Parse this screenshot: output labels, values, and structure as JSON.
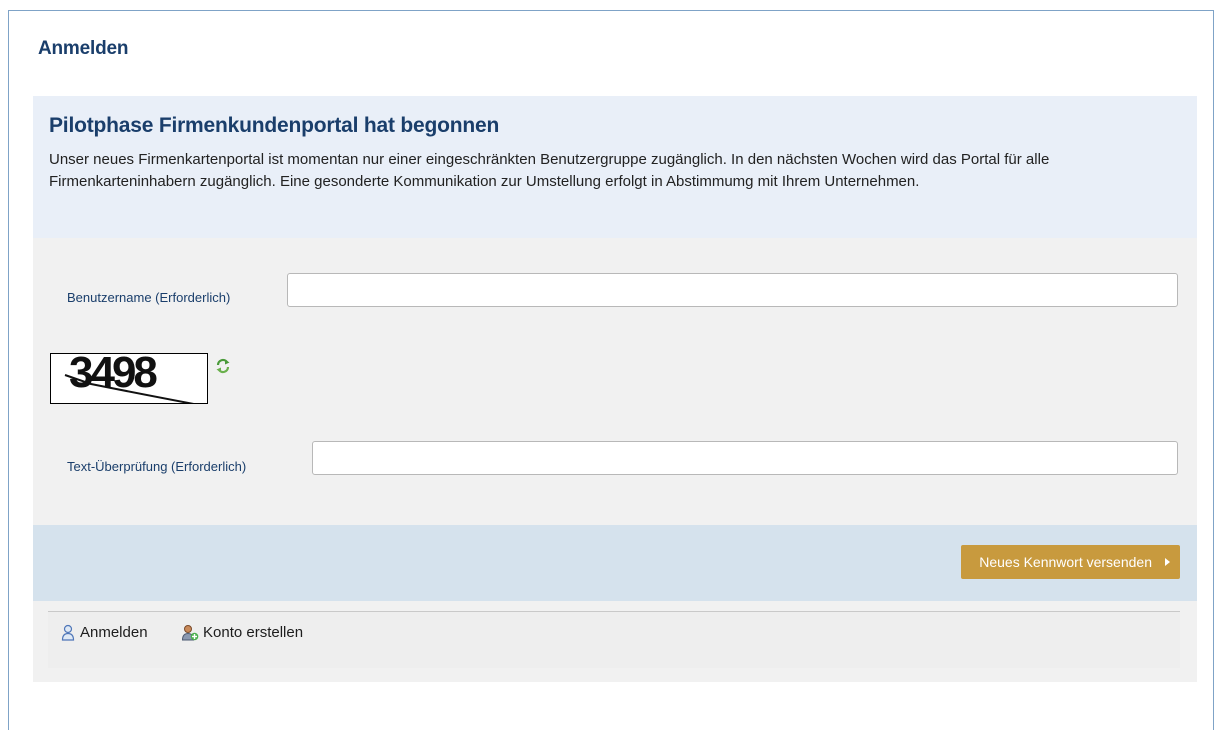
{
  "page": {
    "title": "Anmelden"
  },
  "notice": {
    "title": "Pilotphase Firmenkundenportal hat begonnen",
    "body": "Unser neues Firmenkartenportal ist momentan nur einer eingeschränkten Benutzergruppe zugänglich. In den nächsten Wochen wird das Portal für alle Firmenkarteninhabern zugänglich. Eine gesonderte Kommunikation zur Umstellung erfolgt in Abstimmumg mit Ihrem Unternehmen."
  },
  "form": {
    "username_label": "Benutzername (Erforderlich)",
    "username_value": "",
    "captcha_text": "3498",
    "verification_label": "Text-Überprüfung (Erforderlich)",
    "verification_value": ""
  },
  "actions": {
    "send_password_label": "Neues Kennwort versenden"
  },
  "footer": {
    "login_label": "Anmelden",
    "create_account_label": "Konto erstellen"
  },
  "icons": {
    "refresh": "refresh-icon",
    "user": "user-icon",
    "add_user": "add-user-icon"
  },
  "colors": {
    "heading": "#1a3e6b",
    "notice_bg": "#e9eff8",
    "form_bg": "#f1f1f1",
    "action_bar_bg": "#d5e2ed",
    "button_bg": "#c89a3e"
  }
}
